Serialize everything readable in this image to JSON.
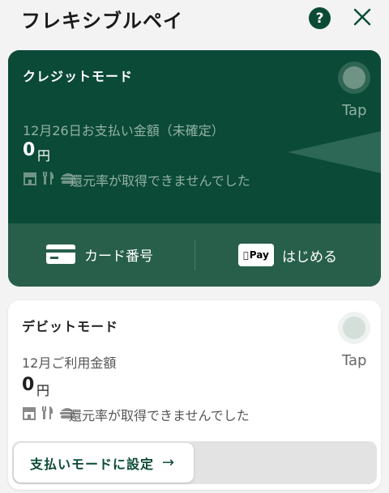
{
  "header": {
    "title": "フレキシブルペイ",
    "help_glyph": "?",
    "help_icon": "question-icon",
    "close_icon": "close-icon"
  },
  "credit_card": {
    "mode_label": "クレジットモード",
    "tap_label": "Tap",
    "amount_label": "12月26日お支払い金額（未確定）",
    "amount_value": "0",
    "amount_unit": "円",
    "category_icons": [
      "store-icon",
      "restaurant-icon",
      "burger-icon"
    ],
    "rate_text": "還元率が取得できませんでした",
    "card_number_label": "カード番号",
    "applepay_badge": "Pay",
    "applepay_label": "はじめる",
    "colors": {
      "background": "#0b4a36",
      "footer": "#275f4b"
    }
  },
  "debit_card": {
    "mode_label": "デビットモード",
    "tap_label": "Tap",
    "amount_label": "12月ご利用金額",
    "amount_value": "0",
    "amount_unit": "円",
    "category_icons": [
      "store-icon",
      "restaurant-icon",
      "burger-icon"
    ],
    "rate_text": "還元率が取得できませんでした",
    "set_mode_label": "支払いモードに設定",
    "set_mode_arrow": "→"
  }
}
